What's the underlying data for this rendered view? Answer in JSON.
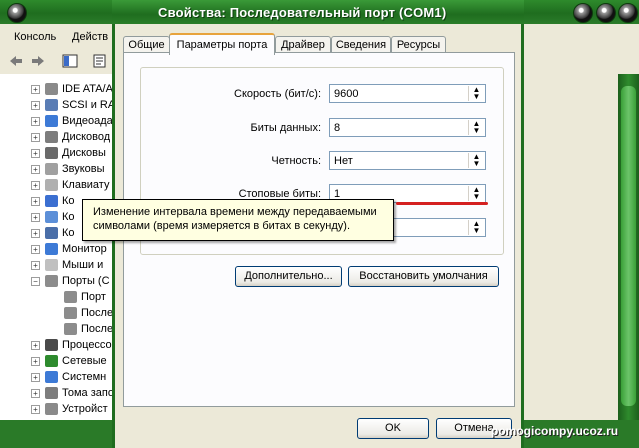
{
  "background_window": {
    "menu": [
      "Консоль",
      "Действ"
    ],
    "tree": [
      {
        "label": "IDE ATA/A",
        "color": "#8a8a8a"
      },
      {
        "label": "SCSI и RA",
        "color": "#5a7db5"
      },
      {
        "label": "Видеоада",
        "color": "#3d7ad6"
      },
      {
        "label": "Дисковод",
        "color": "#7d7d7d"
      },
      {
        "label": "Дисковы",
        "color": "#6a6a6a"
      },
      {
        "label": "Звуковы",
        "color": "#a0a0a0"
      },
      {
        "label": "Клавиату",
        "color": "#b0b0b0"
      },
      {
        "label": "Ко",
        "color": "#3b6fd1"
      },
      {
        "label": "Ко",
        "color": "#5c8fd8"
      },
      {
        "label": "Ко",
        "color": "#4a6ea8"
      },
      {
        "label": "Монитор",
        "color": "#3d7ad6"
      },
      {
        "label": "Мыши и",
        "color": "#c0c0c0"
      },
      {
        "label": "Порты (C",
        "color": "#8c8c8c",
        "expanded": true
      },
      {
        "label": "Порт",
        "color": "#8c8c8c",
        "child": true
      },
      {
        "label": "После",
        "color": "#8c8c8c",
        "child": true
      },
      {
        "label": "После",
        "color": "#8c8c8c",
        "child": true
      },
      {
        "label": "Процессо",
        "color": "#4a4a4a"
      },
      {
        "label": "Сетевые",
        "color": "#2e8b2e"
      },
      {
        "label": "Системн",
        "color": "#3d7ad6"
      },
      {
        "label": "Тома запо",
        "color": "#7d7d7d"
      },
      {
        "label": "Устройст",
        "color": "#8a8a8a"
      }
    ]
  },
  "dialog": {
    "title": "Свойства: Последовательный порт (COM1)",
    "tabs": [
      "Общие",
      "Параметры порта",
      "Драйвер",
      "Сведения",
      "Ресурсы"
    ],
    "active_tab": "Параметры порта",
    "fields": [
      {
        "label": "Скорость (бит/с):",
        "value": "9600"
      },
      {
        "label": "Биты данных:",
        "value": "8"
      },
      {
        "label": "Четность:",
        "value": "Нет"
      },
      {
        "label": "Стоповые биты:",
        "value": "1"
      },
      {
        "label": "",
        "value": ""
      }
    ],
    "tooltip": "Изменение интервала времени между передаваемыми символами (время измеряется в битах в секунду).",
    "advanced_button": "Дополнительно...",
    "restore_button": "Восстановить умолчания",
    "ok_button": "OK",
    "cancel_button": "Отмена"
  },
  "watermark": "pomogicompy.ucoz.ru",
  "colors": {
    "titlebar_green": "#1f6d1f",
    "tooltip_bg": "#ffffe1",
    "highlight_red": "#d42020",
    "tab_active_accent": "#e7a33c"
  }
}
